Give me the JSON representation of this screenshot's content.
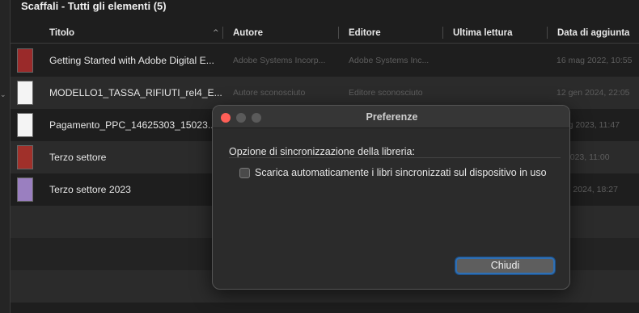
{
  "library": {
    "title": "Scaffali - Tutti gli elementi (5)",
    "columns": {
      "title": "Titolo",
      "author": "Autore",
      "editor": "Editore",
      "last_read": "Ultima lettura",
      "date_added": "Data di aggiunta"
    },
    "books": [
      {
        "title": "Getting Started with Adobe Digital E...",
        "author": "Adobe Systems Incorp...",
        "editor": "Adobe Systems Inc...",
        "last_read": "",
        "date_added": "16 mag 2022, 10:55",
        "thumb": "red-cover"
      },
      {
        "title": "MODELLO1_TASSA_RIFIUTI_rel4_E...",
        "author": "Autore sconosciuto",
        "editor": "Editore sconosciuto",
        "last_read": "",
        "date_added": "12 gen 2024, 22:05",
        "thumb": "white-doc"
      },
      {
        "title": "Pagamento_PPC_14625303_15023...",
        "author": "",
        "editor": "",
        "last_read": "",
        "date_added": "mag 2023, 11:47",
        "thumb": "white-doc"
      },
      {
        "title": "Terzo settore",
        "author": "",
        "editor": "",
        "last_read": "",
        "date_added": "ffi 2023, 11:00",
        "thumb": "red-cover"
      },
      {
        "title": "Terzo settore 2023",
        "author": "",
        "editor": "",
        "last_read": "",
        "date_added": "gen 2024, 18:27",
        "thumb": "purple-cover"
      }
    ]
  },
  "dialog": {
    "title": "Preferenze",
    "section_label": "Opzione di sincronizzazione della libreria:",
    "checkbox_label": "Scarica automaticamente i libri sincronizzati sul dispositivo in uso",
    "checkbox_checked": false,
    "close_label": "Chiudi"
  },
  "colors": {
    "traffic_close": "#ff5f57",
    "traffic_disabled": "#5a5a5a",
    "focus_ring": "#2f6fb3"
  }
}
